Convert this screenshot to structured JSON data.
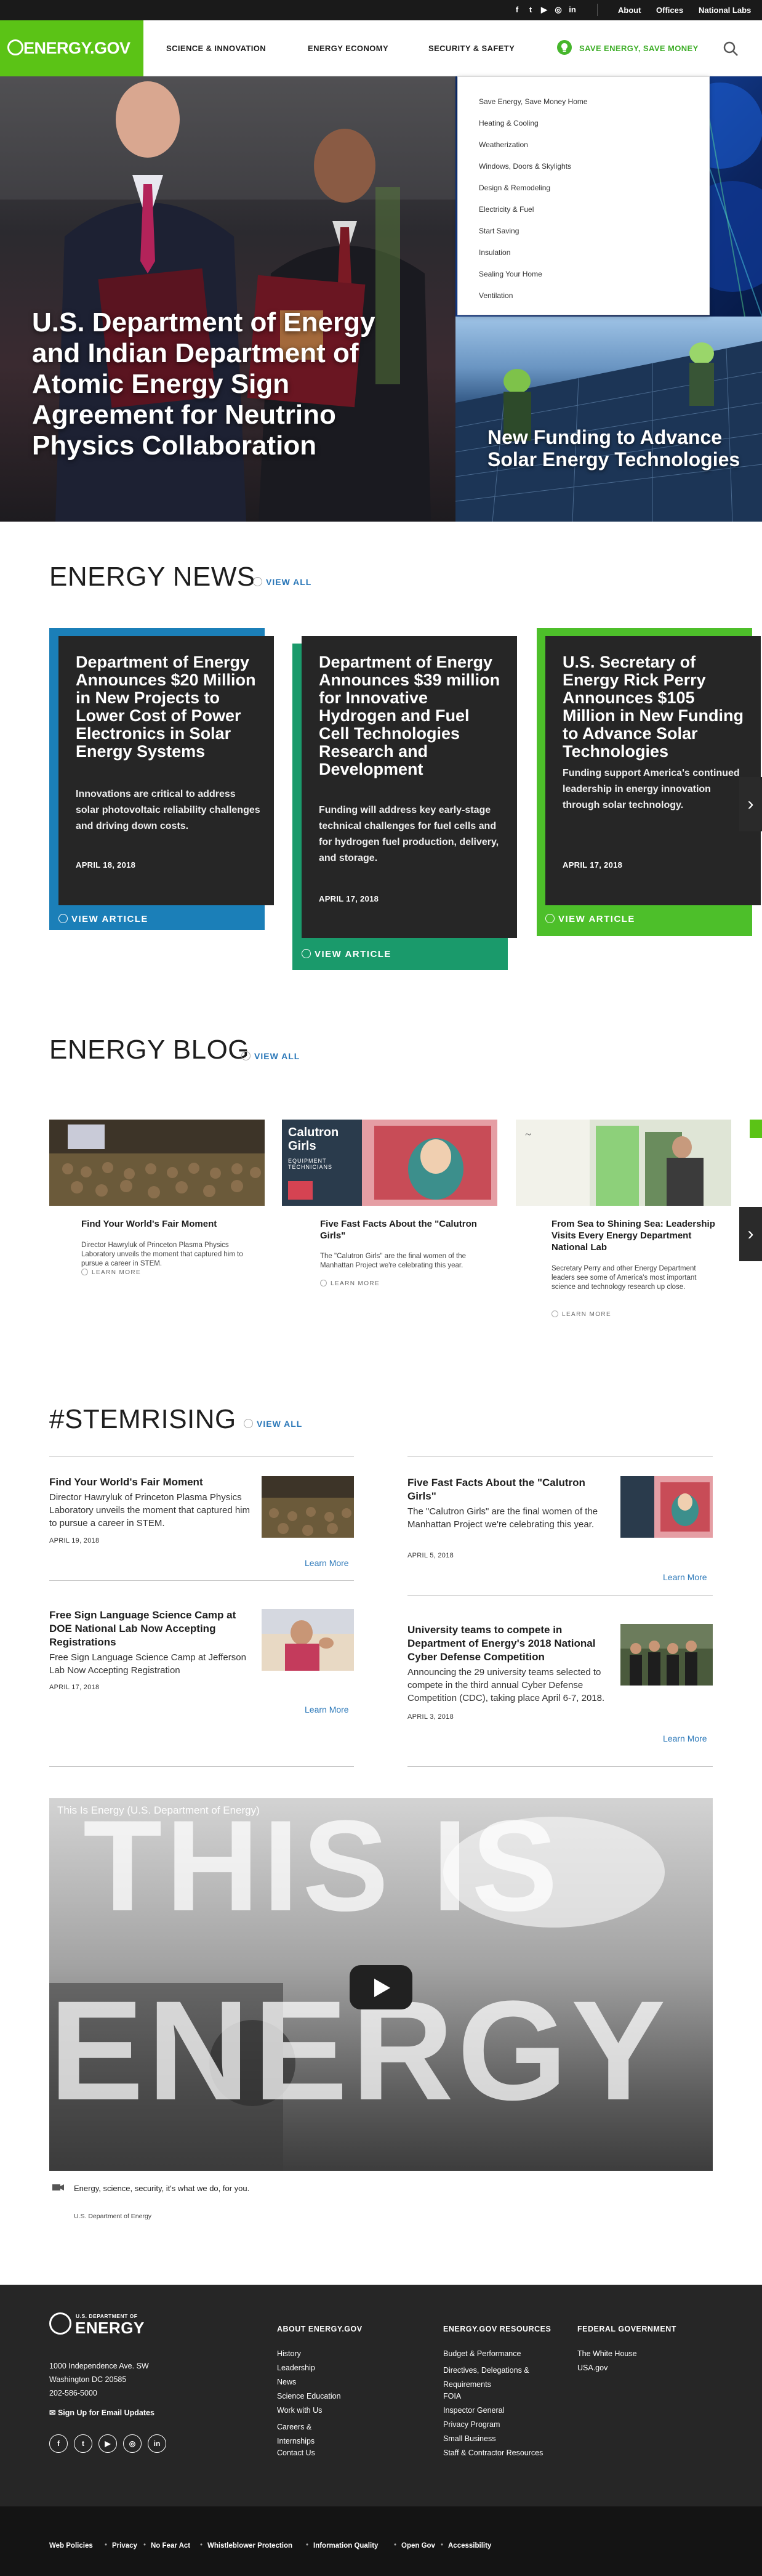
{
  "utility": {
    "social": [
      "f",
      "t",
      "▶",
      "◎",
      "in"
    ],
    "links": [
      "About",
      "Offices",
      "National Labs"
    ]
  },
  "nav": {
    "logo": "ENERGY.GOV",
    "items": [
      "SCIENCE & INNOVATION",
      "ENERGY ECONOMY",
      "SECURITY & SAFETY"
    ],
    "save": "SAVE ENERGY, SAVE MONEY"
  },
  "dropdown": [
    "Save Energy, Save Money Home",
    "Heating & Cooling",
    "Weatherization",
    "Windows, Doors & Skylights",
    "Design & Remodeling",
    "Electricity & Fuel",
    "Start Saving",
    "Insulation",
    "Sealing Your Home",
    "Ventilation"
  ],
  "hero": {
    "title": "U.S. Department of Energy and Indian Department of Atomic Energy Sign Agreement for Neutrino Physics Collaboration",
    "side": "New Funding to Advance Solar Energy Technologies"
  },
  "news": {
    "title": "ENERGY NEWS",
    "view_all": "VIEW ALL",
    "cards": [
      {
        "title": "Department of Energy Announces $20 Million in New Projects to Lower Cost of Power Electronics in Solar Energy Systems",
        "desc": "Innovations are critical to address solar photovoltaic reliability challenges and driving down costs.",
        "date": "APRIL 18, 2018",
        "btn": "VIEW ARTICLE",
        "accent": "#1b7fb8"
      },
      {
        "title": "Department of Energy Announces $39 million for Innovative Hydrogen and Fuel Cell Technologies Research and Development",
        "desc": "Funding will address key early-stage technical challenges for fuel cells and for hydrogen fuel production, delivery, and storage.",
        "date": "APRIL 17, 2018",
        "btn": "VIEW ARTICLE",
        "accent": "#1a9a6b"
      },
      {
        "title": "U.S. Secretary of Energy Rick Perry Announces $105 Million in New Funding to Advance Solar Technologies",
        "desc": "Funding support America's continued leadership in energy innovation through solar technology.",
        "date": "APRIL 17, 2018",
        "btn": "VIEW ARTICLE",
        "accent": "#4dbf2a"
      }
    ]
  },
  "blog": {
    "title": "ENERGY BLOG",
    "view_all": "VIEW ALL",
    "items": [
      {
        "title": "Find Your World's Fair Moment",
        "desc": "Director Hawryluk of Princeton Plasma Physics Laboratory unveils the moment that captured him to pursue a career in STEM.",
        "more": "LEARN MORE"
      },
      {
        "title": "Five Fast Facts About the \"Calutron Girls\"",
        "desc": "The \"Calutron Girls\" are the final women of the Manhattan Project we're celebrating this year.",
        "more": "LEARN MORE",
        "img_title": "Calutron Girls",
        "img_sub": "EQUIPMENT TECHNICIANS"
      },
      {
        "title": "From Sea to Shining Sea: Leadership Visits Every Energy Department National Lab",
        "desc": "Secretary Perry and other Energy Department leaders see some of America's most important science and technology research up close.",
        "more": "LEARN MORE"
      }
    ]
  },
  "stem": {
    "title": "#STEMRISING",
    "view_all": "VIEW ALL",
    "items": [
      {
        "title": "Find Your World's Fair Moment",
        "desc": "Director Hawryluk of Princeton Plasma Physics Laboratory unveils the moment that captured him to pursue a career in STEM.",
        "date": "APRIL 19, 2018",
        "more": "Learn More"
      },
      {
        "title": "Five Fast Facts About the \"Calutron Girls\"",
        "desc": "The \"Calutron Girls\" are the final women of the Manhattan Project we're celebrating this year.",
        "date": "APRIL 5, 2018",
        "more": "Learn More"
      },
      {
        "title": "Free Sign Language Science Camp at DOE National Lab Now Accepting Registrations",
        "desc": "Free Sign Language Science Camp at Jefferson Lab Now Accepting Registration",
        "date": "APRIL 17, 2018",
        "more": "Learn More"
      },
      {
        "title": "University teams to compete in Department of Energy's 2018 National Cyber Defense Competition",
        "desc": "Announcing the 29 university teams selected to compete in the third annual Cyber Defense Competition (CDC), taking place April 6-7, 2018.",
        "date": "APRIL 3, 2018",
        "more": "Learn More"
      }
    ]
  },
  "video": {
    "title": "This Is Energy (U.S. Department of Energy)",
    "big1": "THIS IS",
    "big2": "ENERGY",
    "caption": "Energy, science, security, it's what we do, for you.",
    "credit": "U.S. Department of Energy"
  },
  "footer": {
    "org_sub": "U.S. DEPARTMENT OF",
    "org": "ENERGY",
    "address": [
      "1000 Independence Ave. SW",
      "Washington DC 20585",
      "202-586-5000"
    ],
    "signup": "Sign Up for Email Updates",
    "social": [
      "f",
      "t",
      "▶",
      "◎",
      "in"
    ],
    "cols": [
      {
        "head": "ABOUT ENERGY.GOV",
        "links": [
          "History",
          "Leadership",
          "News",
          "Science Education",
          "Work with Us",
          "Careers & Internships",
          "Contact Us"
        ]
      },
      {
        "head": "ENERGY.GOV RESOURCES",
        "links": [
          "Budget & Performance",
          "Directives, Delegations & Requirements",
          "FOIA",
          "Inspector General",
          "Privacy Program",
          "Small Business",
          "Staff & Contractor Resources"
        ]
      },
      {
        "head": "FEDERAL GOVERNMENT",
        "links": [
          "The White House",
          "USA.gov"
        ]
      }
    ],
    "bottom": [
      "Web Policies",
      "Privacy",
      "No Fear Act",
      "Whistleblower Protection",
      "Information Quality",
      "Open Gov",
      "Accessibility"
    ]
  }
}
